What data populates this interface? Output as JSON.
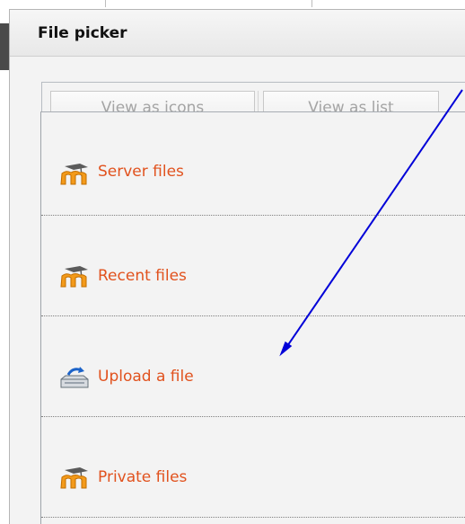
{
  "window": {
    "title": "File picker"
  },
  "view_buttons": {
    "icons_label": "View as icons",
    "list_label": "View as list"
  },
  "repositories": [
    {
      "label": "Server files",
      "icon": "moodle-icon"
    },
    {
      "label": "Recent files",
      "icon": "moodle-icon"
    },
    {
      "label": "Upload a file",
      "icon": "upload-icon"
    },
    {
      "label": "Private files",
      "icon": "moodle-icon"
    }
  ],
  "annotation": {
    "arrow_color": "#0000d8",
    "target": "Upload a file"
  },
  "colors": {
    "repo_label": "#e1521e",
    "moodle_orange": "#f39a1a",
    "dialog_bg": "#f3f3f3"
  }
}
